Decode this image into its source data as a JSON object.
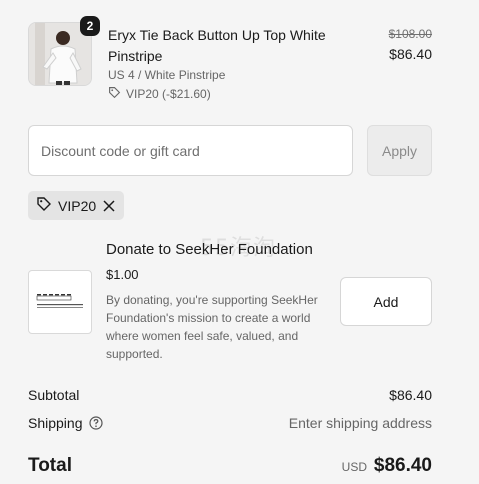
{
  "line_item": {
    "quantity": "2",
    "title": "Eryx Tie Back Button Up Top White Pinstripe",
    "variant": "US 4 / White Pinstripe",
    "discount": "VIP20 (-$21.60)",
    "original_price": "$108.00",
    "price": "$86.40",
    "icon": "tag-icon"
  },
  "discount_form": {
    "placeholder": "Discount code or gift card",
    "value": "",
    "apply_label": "Apply"
  },
  "applied_code": {
    "code": "VIP20",
    "tag_icon": "tag-icon",
    "remove_icon": "close-icon"
  },
  "donation": {
    "title": "Donate to SeekHer Foundation",
    "amount": "$1.00",
    "description": "By donating, you're supporting SeekHer Foundation's mission to create a world where women feel safe, valued, and supported.",
    "logo_text": "SEEKHER FOUNDATION",
    "add_label": "Add"
  },
  "summary": {
    "subtotal_label": "Subtotal",
    "subtotal_value": "$86.40",
    "shipping_label": "Shipping",
    "shipping_value": "Enter shipping address",
    "help_icon": "help-circle-icon",
    "total_label": "Total",
    "currency": "USD",
    "total_value": "$86.40"
  },
  "watermark": "55海淘",
  "colors": {
    "background": "#f5f5f5",
    "text": "#1a1a1a",
    "muted": "#666666",
    "badge": "#1a1a1a"
  }
}
